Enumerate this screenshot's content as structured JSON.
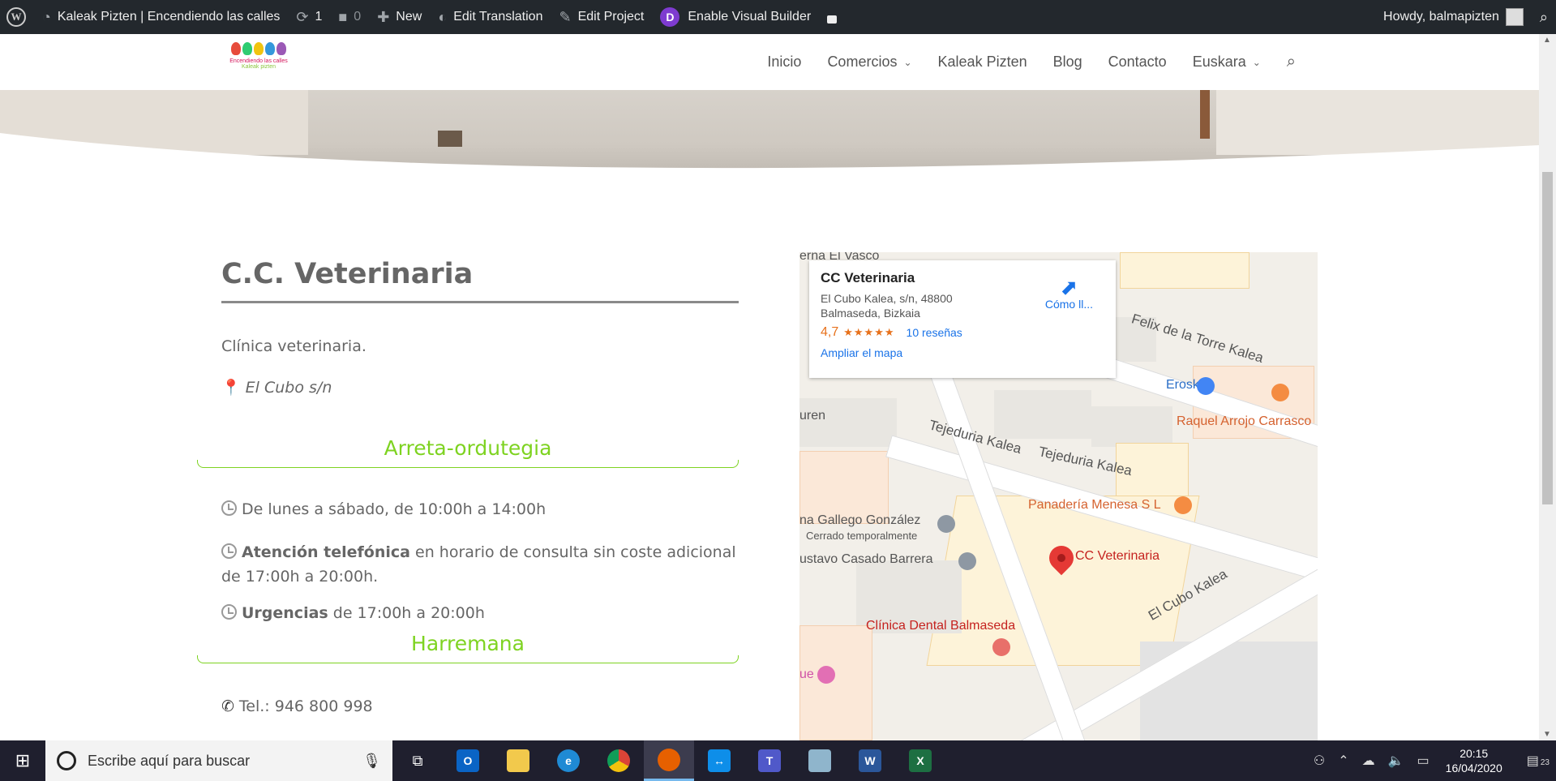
{
  "adminbar": {
    "site_name": "Kaleak Pizten | Encendiendo las calles",
    "updates_count": "1",
    "comments_count": "0",
    "new_label": "New",
    "edit_translation": "Edit Translation",
    "edit_project": "Edit Project",
    "visual_builder_badge": "D",
    "visual_builder": "Enable Visual Builder",
    "howdy": "Howdy, balmapizten"
  },
  "header": {
    "logo_line1": "Encendiendo las calles",
    "logo_line2": "Kaleak pizten",
    "nav": [
      "Inicio",
      "Comercios",
      "Kaleak Pizten",
      "Blog",
      "Contacto",
      "Euskara"
    ]
  },
  "content": {
    "title": "C.C. Veterinaria",
    "description": "Clínica veterinaria.",
    "address": "El Cubo s/n",
    "section_hours": "Arreta-ordutegia",
    "hours": [
      {
        "bold": "",
        "text": "De lunes a sábado, de 10:00h a 14:00h"
      },
      {
        "bold": "Atención telefónica",
        "text": " en horario de consulta sin coste adicional de 17:00h a 20:00h."
      },
      {
        "bold": "Urgencias",
        "text": " de 17:00h a 20:00h"
      }
    ],
    "section_contact": "Harremana",
    "phone": "Tel.: 946 800 998"
  },
  "map": {
    "card_name": "CC Veterinaria",
    "card_address": "El Cubo Kalea, s/n, 48800 Balmaseda, Bizkaia",
    "rating": "4,7",
    "stars": "★★★★★",
    "reviews": "10 reseñas",
    "enlarge": "Ampliar el mapa",
    "directions": "Cómo ll...",
    "labels": {
      "vasco": "erna El Vasco",
      "felix": "Felix de la Torre Kalea",
      "eroski": "Eroski",
      "raquel": "Raquel Arrojo Carrasco",
      "uren": "uren",
      "tejeduria1": "Tejeduria Kalea",
      "tejeduria2": "Tejeduria Kalea",
      "panaderia": "Panadería Menesa S L",
      "gallego": "na Gallego González",
      "cerrado": "Cerrado temporalmente",
      "casado": "ustavo Casado Barrera",
      "ccvet": "CC Veterinaria",
      "elcubo": "El Cubo Kalea",
      "dental": "Clínica Dental Balmaseda",
      "ue": "ue"
    }
  },
  "taskbar": {
    "search_placeholder": "Escribe aquí para buscar",
    "time": "20:15",
    "date": "16/04/2020",
    "notifications": "23"
  }
}
